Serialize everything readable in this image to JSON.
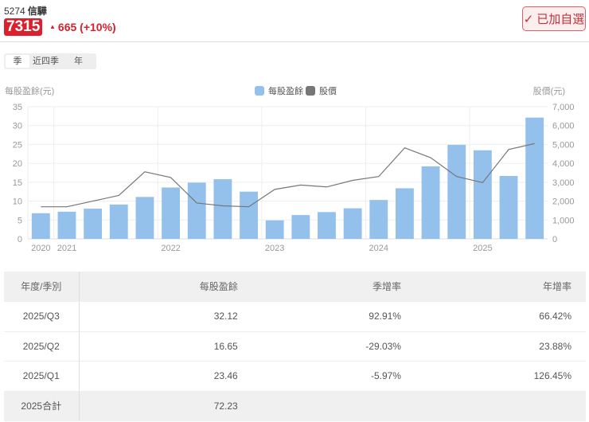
{
  "header": {
    "code": "5274",
    "name": "信驊",
    "price": "7315",
    "change": "665 (+10%)",
    "fav_label": "已加自選"
  },
  "tabs": [
    "季",
    "近四季",
    "年"
  ],
  "chart_data": {
    "type": "bar+line",
    "left_axis_label": "每股盈餘(元)",
    "right_axis_label": "股價(元)",
    "legend": [
      "每股盈餘",
      "股價"
    ],
    "colors": {
      "eps": "#94c0ec",
      "price": "#777777"
    },
    "ylim": [
      0,
      35
    ],
    "y_ticks": [
      "0",
      "5",
      "10",
      "15",
      "20",
      "25",
      "30",
      "35"
    ],
    "y2lim": [
      0,
      7000
    ],
    "y2_ticks": [
      "0",
      "1,000",
      "2,000",
      "3,000",
      "4,000",
      "5,000",
      "6,000",
      "7,000"
    ],
    "categories": [
      "2020Q4",
      "2021Q1",
      "2021Q2",
      "2021Q3",
      "2021Q4",
      "2022Q1",
      "2022Q2",
      "2022Q3",
      "2022Q4",
      "2023Q1",
      "2023Q2",
      "2023Q3",
      "2023Q4",
      "2024Q1",
      "2024Q2",
      "2024Q3",
      "2024Q4",
      "2025Q1",
      "2025Q2",
      "2025Q3"
    ],
    "x_labels": [
      {
        "i": 0,
        "t": "2020"
      },
      {
        "i": 1,
        "t": "2021"
      },
      {
        "i": 5,
        "t": "2022"
      },
      {
        "i": 9,
        "t": "2023"
      },
      {
        "i": 13,
        "t": "2024"
      },
      {
        "i": 17,
        "t": "2025"
      }
    ],
    "series": [
      {
        "name": "每股盈餘",
        "values": [
          6.8,
          7.2,
          8.0,
          9.1,
          11.1,
          13.6,
          14.9,
          15.8,
          12.5,
          4.9,
          6.3,
          7.1,
          8.1,
          10.3,
          13.4,
          19.2,
          24.9,
          23.46,
          16.65,
          32.12
        ]
      },
      {
        "name": "股價",
        "values": [
          1700,
          1700,
          2000,
          2300,
          3550,
          3250,
          1900,
          1750,
          1700,
          2620,
          2850,
          2750,
          3100,
          3300,
          4820,
          4300,
          3300,
          2980,
          4730,
          5050
        ]
      }
    ]
  },
  "table": {
    "headers": [
      "年度/季別",
      "每股盈餘",
      "季增率",
      "年增率"
    ],
    "rows": [
      [
        "2025/Q3",
        "32.12",
        "92.91%",
        "66.42%"
      ],
      [
        "2025/Q2",
        "16.65",
        "-29.03%",
        "23.88%"
      ],
      [
        "2025/Q1",
        "23.46",
        "-5.97%",
        "126.45%"
      ],
      [
        "2025合計",
        "72.23",
        "",
        ""
      ]
    ]
  }
}
